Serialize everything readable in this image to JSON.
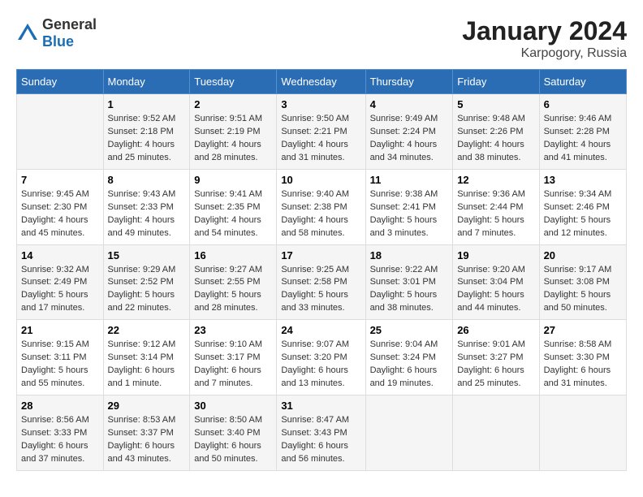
{
  "logo": {
    "general": "General",
    "blue": "Blue"
  },
  "title": "January 2024",
  "subtitle": "Karpogory, Russia",
  "weekdays": [
    "Sunday",
    "Monday",
    "Tuesday",
    "Wednesday",
    "Thursday",
    "Friday",
    "Saturday"
  ],
  "weeks": [
    [
      {
        "day": "",
        "info": ""
      },
      {
        "day": "1",
        "info": "Sunrise: 9:52 AM\nSunset: 2:18 PM\nDaylight: 4 hours\nand 25 minutes."
      },
      {
        "day": "2",
        "info": "Sunrise: 9:51 AM\nSunset: 2:19 PM\nDaylight: 4 hours\nand 28 minutes."
      },
      {
        "day": "3",
        "info": "Sunrise: 9:50 AM\nSunset: 2:21 PM\nDaylight: 4 hours\nand 31 minutes."
      },
      {
        "day": "4",
        "info": "Sunrise: 9:49 AM\nSunset: 2:24 PM\nDaylight: 4 hours\nand 34 minutes."
      },
      {
        "day": "5",
        "info": "Sunrise: 9:48 AM\nSunset: 2:26 PM\nDaylight: 4 hours\nand 38 minutes."
      },
      {
        "day": "6",
        "info": "Sunrise: 9:46 AM\nSunset: 2:28 PM\nDaylight: 4 hours\nand 41 minutes."
      }
    ],
    [
      {
        "day": "7",
        "info": "Sunrise: 9:45 AM\nSunset: 2:30 PM\nDaylight: 4 hours\nand 45 minutes."
      },
      {
        "day": "8",
        "info": "Sunrise: 9:43 AM\nSunset: 2:33 PM\nDaylight: 4 hours\nand 49 minutes."
      },
      {
        "day": "9",
        "info": "Sunrise: 9:41 AM\nSunset: 2:35 PM\nDaylight: 4 hours\nand 54 minutes."
      },
      {
        "day": "10",
        "info": "Sunrise: 9:40 AM\nSunset: 2:38 PM\nDaylight: 4 hours\nand 58 minutes."
      },
      {
        "day": "11",
        "info": "Sunrise: 9:38 AM\nSunset: 2:41 PM\nDaylight: 5 hours\nand 3 minutes."
      },
      {
        "day": "12",
        "info": "Sunrise: 9:36 AM\nSunset: 2:44 PM\nDaylight: 5 hours\nand 7 minutes."
      },
      {
        "day": "13",
        "info": "Sunrise: 9:34 AM\nSunset: 2:46 PM\nDaylight: 5 hours\nand 12 minutes."
      }
    ],
    [
      {
        "day": "14",
        "info": "Sunrise: 9:32 AM\nSunset: 2:49 PM\nDaylight: 5 hours\nand 17 minutes."
      },
      {
        "day": "15",
        "info": "Sunrise: 9:29 AM\nSunset: 2:52 PM\nDaylight: 5 hours\nand 22 minutes."
      },
      {
        "day": "16",
        "info": "Sunrise: 9:27 AM\nSunset: 2:55 PM\nDaylight: 5 hours\nand 28 minutes."
      },
      {
        "day": "17",
        "info": "Sunrise: 9:25 AM\nSunset: 2:58 PM\nDaylight: 5 hours\nand 33 minutes."
      },
      {
        "day": "18",
        "info": "Sunrise: 9:22 AM\nSunset: 3:01 PM\nDaylight: 5 hours\nand 38 minutes."
      },
      {
        "day": "19",
        "info": "Sunrise: 9:20 AM\nSunset: 3:04 PM\nDaylight: 5 hours\nand 44 minutes."
      },
      {
        "day": "20",
        "info": "Sunrise: 9:17 AM\nSunset: 3:08 PM\nDaylight: 5 hours\nand 50 minutes."
      }
    ],
    [
      {
        "day": "21",
        "info": "Sunrise: 9:15 AM\nSunset: 3:11 PM\nDaylight: 5 hours\nand 55 minutes."
      },
      {
        "day": "22",
        "info": "Sunrise: 9:12 AM\nSunset: 3:14 PM\nDaylight: 6 hours\nand 1 minute."
      },
      {
        "day": "23",
        "info": "Sunrise: 9:10 AM\nSunset: 3:17 PM\nDaylight: 6 hours\nand 7 minutes."
      },
      {
        "day": "24",
        "info": "Sunrise: 9:07 AM\nSunset: 3:20 PM\nDaylight: 6 hours\nand 13 minutes."
      },
      {
        "day": "25",
        "info": "Sunrise: 9:04 AM\nSunset: 3:24 PM\nDaylight: 6 hours\nand 19 minutes."
      },
      {
        "day": "26",
        "info": "Sunrise: 9:01 AM\nSunset: 3:27 PM\nDaylight: 6 hours\nand 25 minutes."
      },
      {
        "day": "27",
        "info": "Sunrise: 8:58 AM\nSunset: 3:30 PM\nDaylight: 6 hours\nand 31 minutes."
      }
    ],
    [
      {
        "day": "28",
        "info": "Sunrise: 8:56 AM\nSunset: 3:33 PM\nDaylight: 6 hours\nand 37 minutes."
      },
      {
        "day": "29",
        "info": "Sunrise: 8:53 AM\nSunset: 3:37 PM\nDaylight: 6 hours\nand 43 minutes."
      },
      {
        "day": "30",
        "info": "Sunrise: 8:50 AM\nSunset: 3:40 PM\nDaylight: 6 hours\nand 50 minutes."
      },
      {
        "day": "31",
        "info": "Sunrise: 8:47 AM\nSunset: 3:43 PM\nDaylight: 6 hours\nand 56 minutes."
      },
      {
        "day": "",
        "info": ""
      },
      {
        "day": "",
        "info": ""
      },
      {
        "day": "",
        "info": ""
      }
    ]
  ]
}
